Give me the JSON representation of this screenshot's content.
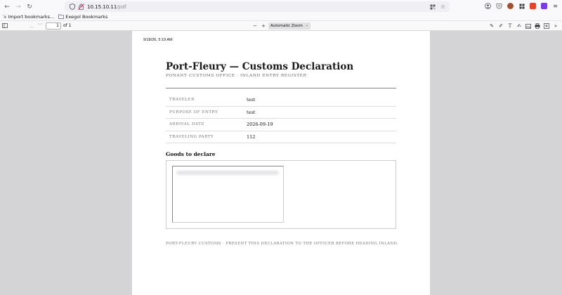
{
  "browser": {
    "url_host": "10.15.10.11",
    "url_path": "/pdf",
    "bookmarks": [
      {
        "label": "Import bookmarks...",
        "icon": "import-icon"
      },
      {
        "label": "Exegol Bookmarks",
        "icon": "folder-icon"
      }
    ]
  },
  "pdf_toolbar": {
    "page_number": "1",
    "page_count_label": "of 1",
    "zoom": "Automatic Zoom"
  },
  "document": {
    "print_date": "9/18/26, 5:19 AM",
    "title": "Port-Fleury — Customs Declaration",
    "subtitle": "PONANT CUSTOMS OFFICE · INLAND ENTRY REGISTER",
    "fields": [
      {
        "label": "TRAVELER",
        "value": "test"
      },
      {
        "label": "PURPOSE OF ENTRY",
        "value": "test"
      },
      {
        "label": "ARRIVAL DATE",
        "value": "2026-09-19"
      },
      {
        "label": "TRAVELING PARTY",
        "value": "112"
      }
    ],
    "goods_heading": "Goods to declare",
    "footer": "PORT-FLEURY CUSTOMS · PRESENT THIS DECLARATION TO THE OFFICER BEFORE HEADING INLAND."
  },
  "colors": {
    "viewer_bg": "#d4d4d7",
    "toolbar_bg": "#f9f9fb",
    "ext_red": "#e0462b",
    "ext_orange": "#f08a24",
    "ext_purple": "#7a3ee0"
  }
}
